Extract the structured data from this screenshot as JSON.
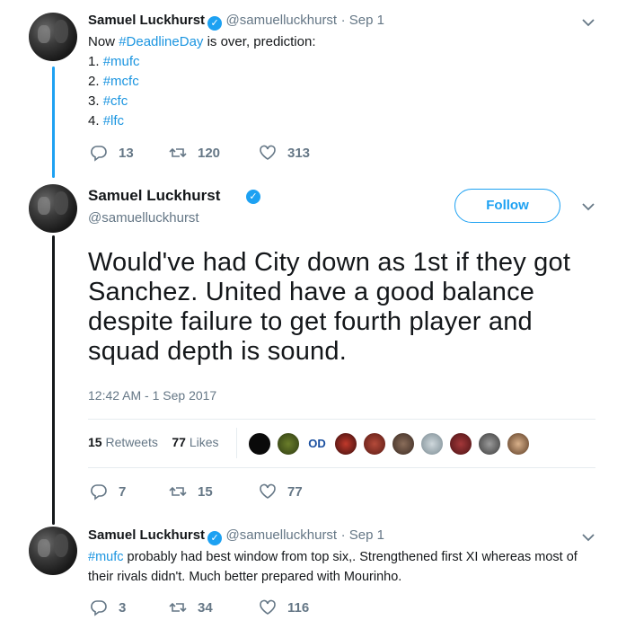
{
  "tweet1": {
    "name": "Samuel Luckhurst",
    "handle": "@samuelluckhurst",
    "date": "· Sep 1",
    "line1_pre": "Now ",
    "line1_tag": "#DeadlineDay",
    "line1_post": " is over, prediction:",
    "items": [
      {
        "num": "1. ",
        "tag": "#mufc"
      },
      {
        "num": "2. ",
        "tag": "#mcfc"
      },
      {
        "num": "3. ",
        "tag": "#cfc"
      },
      {
        "num": "4. ",
        "tag": "#lfc"
      }
    ],
    "replies": "13",
    "retweets": "120",
    "likes": "313"
  },
  "tweet2": {
    "name": "Samuel Luckhurst",
    "handle": "@samuelluckhurst",
    "follow_label": "Follow",
    "text": "Would've had City down as 1st if they got Sanchez. United have a good balance despite failure to get fourth player and squad depth is sound.",
    "timestamp": "12:42 AM - 1 Sep 2017",
    "retweets_count": "15",
    "retweets_label": "Retweets",
    "likes_count": "77",
    "likes_label": "Likes",
    "replies": "7",
    "retweets": "15",
    "likes": "77"
  },
  "tweet3": {
    "name": "Samuel Luckhurst",
    "handle": "@samuelluckhurst",
    "date": "· Sep 1",
    "tag": "#mufc",
    "text": " probably had best window from top six,. Strengthened first XI whereas most of their rivals didn't. Much better prepared with Mourinho.",
    "replies": "3",
    "retweets": "34",
    "likes": "116"
  },
  "colors": {
    "accent": "#1da1f2",
    "hashtag": "#1b95e0",
    "secondary_text": "#657786"
  }
}
